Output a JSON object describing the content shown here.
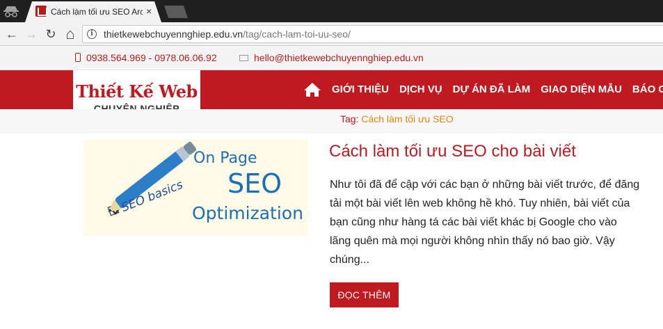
{
  "browser": {
    "tab_title": "Cách làm tối ưu SEO Archives",
    "close_symbol": "×",
    "url_domain": "thietkewebchuyennghiep.edu.vn",
    "url_path": "/tag/cach-lam-toi-uu-seo/",
    "info_symbol": "i",
    "nav": {
      "back": "←",
      "forward": "→",
      "reload": "↻",
      "home": "⌂"
    }
  },
  "contact": {
    "phone": "0938.564.969 - 0978.06.06.92",
    "email": "hello@thietkewebchuyennghiep.edu.vn"
  },
  "logo": {
    "main": "Thiết Kế Web",
    "sub": "CHUYÊN NGHIỆP"
  },
  "menu": [
    "GIỚI THIỆU",
    "DỊCH VỤ",
    "DỰ ÁN ĐÃ LÀM",
    "GIAO DIỆN MẪU",
    "BÁO GIÁ"
  ],
  "tag": {
    "label": "Tag: ",
    "value": "Cách làm tối ưu SEO"
  },
  "article": {
    "title": "Cách làm tối ưu SEO cho bài viết",
    "excerpt": "Như tôi đã để cập với các bạn ở những bài viết trước, để đăng tải một bài viết lên web không hề khó. Tuy nhiên, bài viết của bạn cũng như hàng tá các bài viết khác bị Google cho vào lãng quên mà mọi người không nhìn thấy nó bao giờ.  Vậy chúng...",
    "read_more": "ĐỌC THÊM",
    "thumb": {
      "line1": "On Page",
      "line2": "SEO",
      "line3": "Optimization",
      "pen_text": "SEO basics"
    }
  },
  "colors": {
    "brand_red": "#c0191f",
    "tag_orange": "#e8850a",
    "thumb_blue": "#1a6fb5"
  }
}
